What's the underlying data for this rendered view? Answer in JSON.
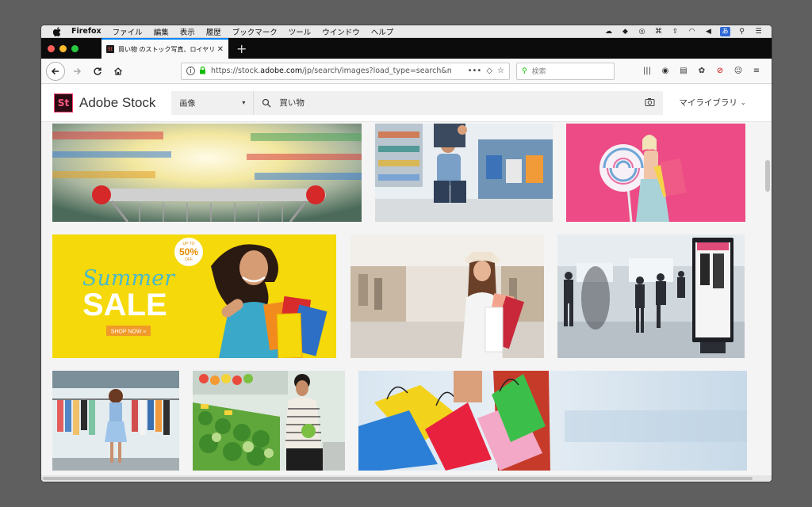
{
  "menubar": {
    "app": "Firefox",
    "items": [
      "ファイル",
      "編集",
      "表示",
      "履歴",
      "ブックマーク",
      "ツール",
      "ウインドウ",
      "ヘルプ"
    ],
    "input_method": "あ"
  },
  "tab": {
    "title": "買い物 のストック写真、ロイヤリ"
  },
  "navbar": {
    "url_prefix": "https://stock.",
    "url_domain": "adobe.com",
    "url_rest": "/jp/search/images?load_type=search&n",
    "search_placeholder": "検索"
  },
  "stock": {
    "logo": "St",
    "brand": "Adobe Stock",
    "asset_type": "画像",
    "query": "買い物",
    "library_label": "マイライブラリ"
  },
  "images": [
    {
      "name": "supermarket-cart-blur",
      "alt": "shopping cart in motion-blurred supermarket aisle"
    },
    {
      "name": "family-grocery-aisle",
      "alt": "father and child shopping in supermarket aisle"
    },
    {
      "name": "lollipop-shopping-bags",
      "alt": "woman with giant lollipop and shopping bags on pink"
    },
    {
      "name": "summer-sale-banner",
      "alt": "summer sale banner with woman holding bags"
    },
    {
      "name": "mall-woman-hat",
      "alt": "woman in hat with shopping bags in mall"
    },
    {
      "name": "mall-crowd-display",
      "alt": "shoppers walking past digital signage in mall"
    },
    {
      "name": "clothing-store",
      "alt": "woman browsing clothing boutique"
    },
    {
      "name": "produce-section",
      "alt": "woman shopping for vegetables"
    },
    {
      "name": "colorful-bags",
      "alt": "hands holding colorful shopping bags"
    }
  ],
  "banner": {
    "script": "Summer",
    "headline": "SALE",
    "badge_top": "UP TO",
    "badge_value": "50%",
    "badge_bottom": "OFF",
    "cta": "SHOP NOW »"
  },
  "colors": {
    "tab_accent": "#0a84ff",
    "banner_yellow": "#f5d90a",
    "pink_bg": "#ec4b86",
    "brand_magenta": "#ff3b6b"
  }
}
